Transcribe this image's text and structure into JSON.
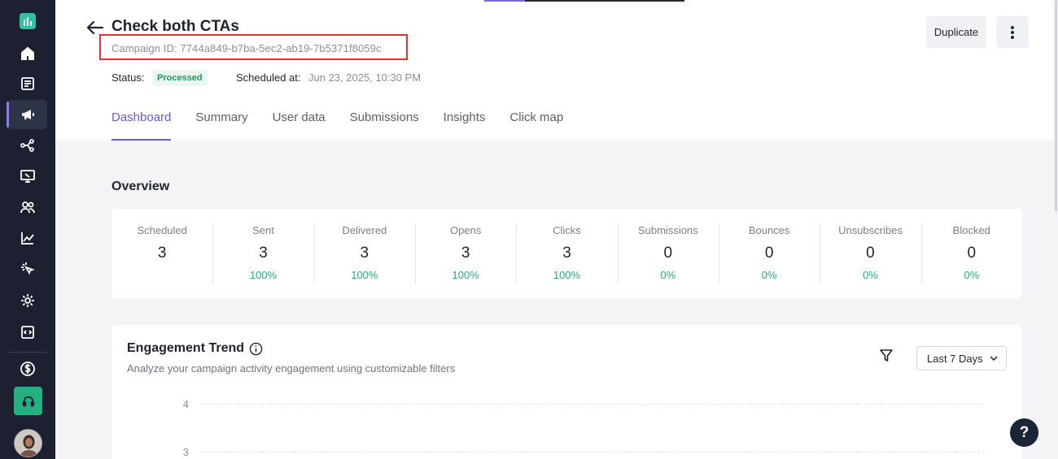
{
  "sidebar": {
    "items": [
      {
        "icon": "home-icon"
      },
      {
        "icon": "document-icon"
      },
      {
        "icon": "megaphone-icon"
      },
      {
        "icon": "flow-icon"
      },
      {
        "icon": "monitor-icon"
      },
      {
        "icon": "users-icon"
      },
      {
        "icon": "chart-icon"
      },
      {
        "icon": "cursor-click-icon"
      },
      {
        "icon": "gear-icon"
      },
      {
        "icon": "code-icon"
      },
      {
        "icon": "dollar-icon"
      }
    ]
  },
  "header": {
    "title": "Check both CTAs",
    "campaign_id": "Campaign ID: 7744a849-b7ba-5ec2-ab19-7b5371f8059c",
    "status_label": "Status:",
    "status_value": "Processed",
    "scheduled_label": "Scheduled at:",
    "scheduled_value": "Jun 23, 2025, 10:30 PM",
    "duplicate_label": "Duplicate"
  },
  "tabs": [
    {
      "label": "Dashboard"
    },
    {
      "label": "Summary"
    },
    {
      "label": "User data"
    },
    {
      "label": "Submissions"
    },
    {
      "label": "Insights"
    },
    {
      "label": "Click map"
    }
  ],
  "overview": {
    "title": "Overview",
    "stats": [
      {
        "label": "Scheduled",
        "value": "3",
        "pct": ""
      },
      {
        "label": "Sent",
        "value": "3",
        "pct": "100%"
      },
      {
        "label": "Delivered",
        "value": "3",
        "pct": "100%"
      },
      {
        "label": "Opens",
        "value": "3",
        "pct": "100%"
      },
      {
        "label": "Clicks",
        "value": "3",
        "pct": "100%"
      },
      {
        "label": "Submissions",
        "value": "0",
        "pct": "0%"
      },
      {
        "label": "Bounces",
        "value": "0",
        "pct": "0%"
      },
      {
        "label": "Unsubscribes",
        "value": "0",
        "pct": "0%"
      },
      {
        "label": "Blocked",
        "value": "0",
        "pct": "0%"
      }
    ]
  },
  "engagement": {
    "title": "Engagement Trend",
    "subtitle": "Analyze your campaign activity engagement using customizable filters",
    "range": "Last 7 Days",
    "y_ticks": [
      "4",
      "3"
    ]
  },
  "help": "?",
  "colors": {
    "accent": "#6e56e8",
    "success": "#22b07a",
    "sidebar": "#1c2030",
    "highlight": "#e8312f"
  }
}
